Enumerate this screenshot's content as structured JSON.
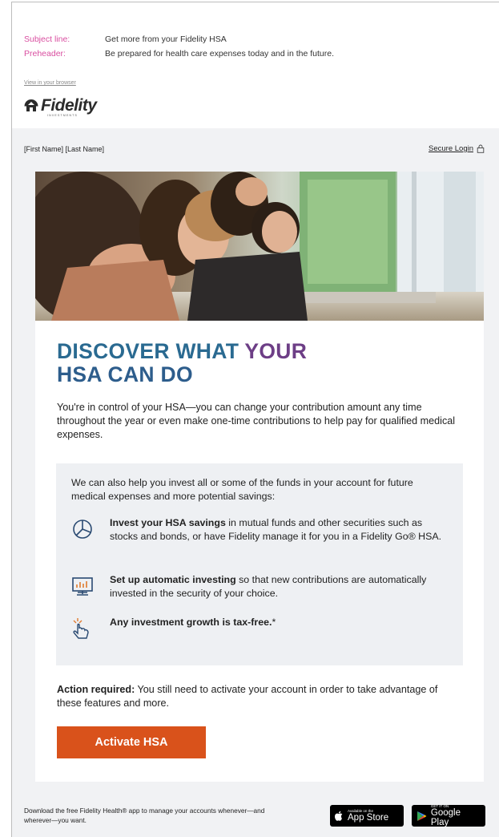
{
  "meta": {
    "subject_label": "Subject line:",
    "subject_value": "Get more from your Fidelity HSA",
    "preheader_label": "Preheader:",
    "preheader_value": "Be prepared for health care expenses today and in the future."
  },
  "view_in_browser": "View in your browser",
  "logo": {
    "word": "Fidelity",
    "sub": "INVESTMENTS"
  },
  "header": {
    "name_placeholder": "[First Name] [Last Name]",
    "secure_login": "Secure Login"
  },
  "headline": {
    "line1_part1": "DISCOVER WHAT ",
    "line1_part2": "YOUR",
    "line2": "HSA CAN DO"
  },
  "intro": "You're in control of your HSA—you can change your contribution amount any time throughout the year or even make one-time contributions to help pay for qualified medical expenses.",
  "box": {
    "lead": "We can also help you invest all or some of the funds in your account for future medical expenses and more potential savings:",
    "features": [
      {
        "icon": "pie-chart-icon",
        "bold": "Invest your HSA savings",
        "rest": " in mutual funds and other securities such as stocks and bonds, or have Fidelity manage it for you in a Fidelity Go® HSA."
      },
      {
        "icon": "monitor-chart-icon",
        "bold": "Set up automatic investing",
        "rest": " so that new contributions are automatically invested in the security of your choice."
      },
      {
        "icon": "hand-click-icon",
        "bold": "Any investment growth is tax-free.",
        "rest": "*"
      }
    ]
  },
  "action": {
    "bold": "Action required:",
    "rest": " You still need to activate your account in order to take advantage of these features and more."
  },
  "cta_label": "Activate HSA",
  "footer": {
    "text": "Download the free Fidelity Health® app to manage your accounts whenever—and wherever—you want.",
    "appstore_small": "Available on the",
    "appstore_big": "App Store",
    "googleplay_small": "GET IT ON",
    "googleplay_big": "Google Play"
  },
  "colors": {
    "pink": "#d94ea0",
    "teal": "#2a6a91",
    "purple": "#6d3e86",
    "cta": "#d9521b",
    "panel": "#f1f2f4"
  }
}
